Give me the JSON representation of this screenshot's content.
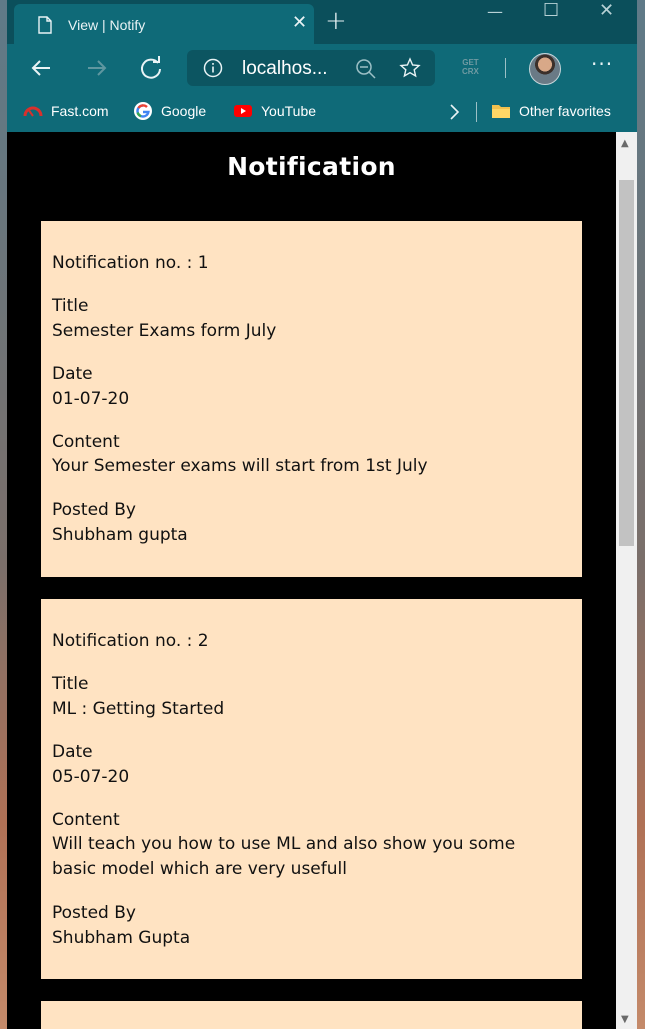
{
  "browser": {
    "tab_title": "View | Notify",
    "url": "localhos...",
    "extension_label_line1": "GET",
    "extension_label_line2": "CRX",
    "favorites": [
      {
        "label": "Fast.com",
        "icon": "fastcom-icon"
      },
      {
        "label": "Google",
        "icon": "google-icon"
      },
      {
        "label": "YouTube",
        "icon": "youtube-icon"
      }
    ],
    "other_favorites": "Other favorites",
    "colors": {
      "frame": "#0f6a78",
      "tabstrip": "#0b4f5b",
      "card": "#ffe3c2",
      "page_bg": "#000000"
    }
  },
  "page": {
    "title": "Notification",
    "notifications": [
      {
        "number_label": "Notification no. : 1",
        "title_label": "Title",
        "title": "Semester Exams form July",
        "date_label": "Date",
        "date": "01-07-20",
        "content_label": "Content",
        "content": "Your Semester exams will start from 1st July",
        "posted_label": "Posted By",
        "posted_by": "Shubham gupta"
      },
      {
        "number_label": "Notification no. : 2",
        "title_label": "Title",
        "title": "ML : Getting Started",
        "date_label": "Date",
        "date": "05-07-20",
        "content_label": "Content",
        "content": "Will teach you how to use ML and also show you some basic model which are very usefull",
        "posted_label": "Posted By",
        "posted_by": "Shubham Gupta"
      }
    ]
  }
}
